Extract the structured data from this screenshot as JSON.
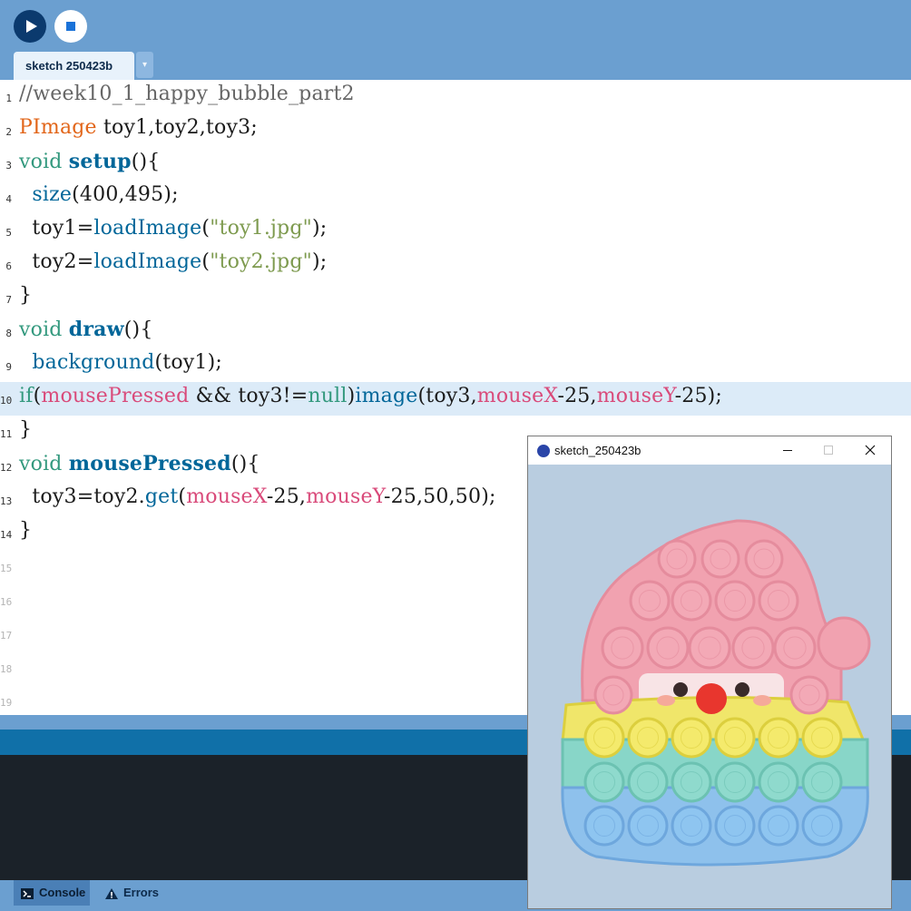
{
  "toolbar": {
    "run_icon": "play-icon",
    "stop_icon": "stop-icon"
  },
  "tab": {
    "name": "sketch 250423b",
    "menu_icon": "▾"
  },
  "editor": {
    "line_numbers": [
      "1",
      "2",
      "3",
      "4",
      "5",
      "6",
      "7",
      "8",
      "9",
      "10",
      "11",
      "12",
      "13",
      "14",
      "15",
      "16",
      "17",
      "18",
      "19"
    ],
    "lines": [
      [
        {
          "t": "//week10_1_happy_bubble_part2",
          "c": "cmt"
        }
      ],
      [
        {
          "t": "PImage",
          "c": "kw-type"
        },
        {
          "t": " toy1,toy2,toy3;",
          "c": ""
        }
      ],
      [
        {
          "t": "void",
          "c": "kw"
        },
        {
          "t": " ",
          "c": ""
        },
        {
          "t": "setup",
          "c": "fnb"
        },
        {
          "t": "(){",
          "c": ""
        }
      ],
      [
        {
          "t": "  ",
          "c": ""
        },
        {
          "t": "size",
          "c": "fn"
        },
        {
          "t": "(400,495);",
          "c": ""
        }
      ],
      [
        {
          "t": "  toy1=",
          "c": ""
        },
        {
          "t": "loadImage",
          "c": "fn"
        },
        {
          "t": "(",
          "c": ""
        },
        {
          "t": "\"toy1.jpg\"",
          "c": "str"
        },
        {
          "t": ");",
          "c": ""
        }
      ],
      [
        {
          "t": "  toy2=",
          "c": ""
        },
        {
          "t": "loadImage",
          "c": "fn"
        },
        {
          "t": "(",
          "c": ""
        },
        {
          "t": "\"toy2.jpg\"",
          "c": "str"
        },
        {
          "t": ");",
          "c": ""
        }
      ],
      [
        {
          "t": "}",
          "c": ""
        }
      ],
      [
        {
          "t": "void",
          "c": "kw"
        },
        {
          "t": " ",
          "c": ""
        },
        {
          "t": "draw",
          "c": "fnb"
        },
        {
          "t": "(){",
          "c": ""
        }
      ],
      [
        {
          "t": "  ",
          "c": ""
        },
        {
          "t": "background",
          "c": "fn"
        },
        {
          "t": "(toy1);",
          "c": ""
        }
      ],
      [
        {
          "t": "if",
          "c": "kw"
        },
        {
          "t": "(",
          "c": ""
        },
        {
          "t": "mousePressed",
          "c": "var"
        },
        {
          "t": " && toy3!=",
          "c": ""
        },
        {
          "t": "null",
          "c": "nul"
        },
        {
          "t": ")",
          "c": ""
        },
        {
          "t": "image",
          "c": "fn"
        },
        {
          "t": "(toy3,",
          "c": ""
        },
        {
          "t": "mouseX",
          "c": "var"
        },
        {
          "t": "-25,",
          "c": ""
        },
        {
          "t": "mouseY",
          "c": "var"
        },
        {
          "t": "-25);",
          "c": ""
        }
      ],
      [
        {
          "t": "}",
          "c": ""
        }
      ],
      [
        {
          "t": "void",
          "c": "kw"
        },
        {
          "t": " ",
          "c": ""
        },
        {
          "t": "mousePressed",
          "c": "fnb"
        },
        {
          "t": "(){",
          "c": ""
        }
      ],
      [
        {
          "t": "  toy3=toy2.",
          "c": ""
        },
        {
          "t": "get",
          "c": "fn"
        },
        {
          "t": "(",
          "c": ""
        },
        {
          "t": "mouseX",
          "c": "var"
        },
        {
          "t": "-25,",
          "c": ""
        },
        {
          "t": "mouseY",
          "c": "var"
        },
        {
          "t": "-25,50,50);",
          "c": ""
        }
      ],
      [
        {
          "t": "}",
          "c": ""
        }
      ]
    ],
    "highlighted_line": 10
  },
  "bottom_tabs": {
    "console": "Console",
    "errors": "Errors"
  },
  "sketch_window": {
    "title": "sketch_250423b",
    "minimize_icon": "minimize-icon",
    "maximize_icon": "maximize-icon",
    "close_icon": "close-icon"
  },
  "colors": {
    "toolbar_bg": "#6b9fd0",
    "run_button": "#0b3a6e",
    "highlight_line": "#dcebf8",
    "console_bg": "#1b2229",
    "status_bar": "#1070a8"
  }
}
